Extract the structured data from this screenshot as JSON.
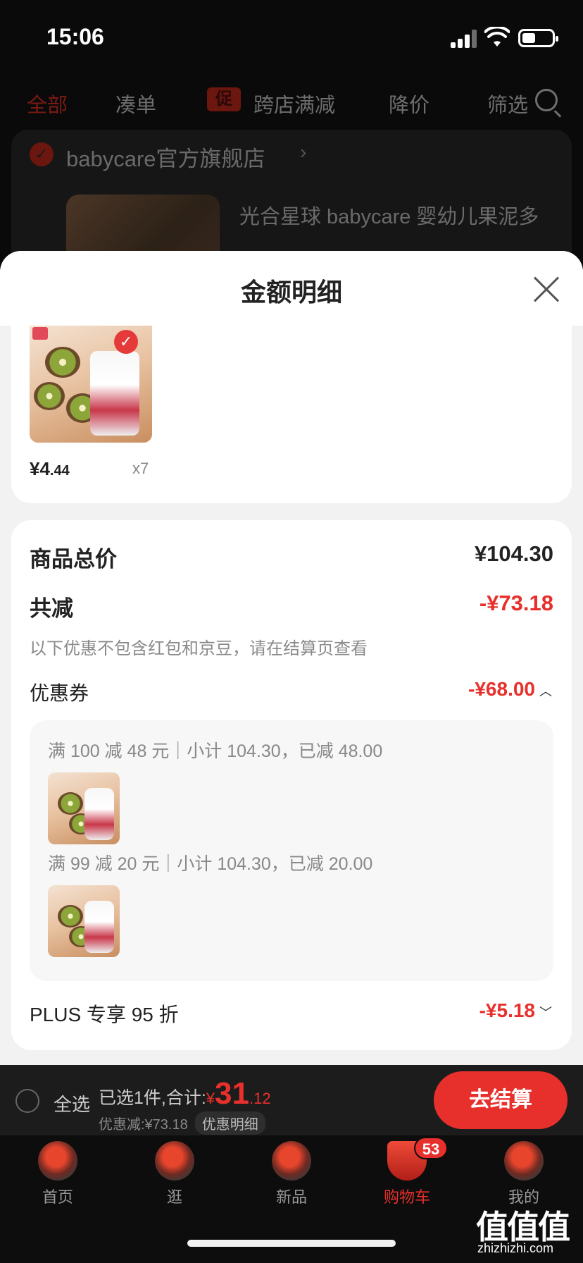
{
  "status_bar": {
    "time": "15:06"
  },
  "filter_bar": {
    "tabs": [
      "全部",
      "凑单",
      "跨店满减",
      "降价",
      "筛选"
    ],
    "promo_tag": "促"
  },
  "shop": {
    "name": "babycare官方旗舰店",
    "arrow": "›",
    "product_title": "光合星球 babycare 婴幼儿果泥多"
  },
  "sheet": {
    "title": "金额明细",
    "product": {
      "price_main": "¥4",
      "price_cents": ".44",
      "qty": "x7"
    },
    "summary": {
      "total_label": "商品总价",
      "total_value": "¥104.30",
      "reduce_label": "共减",
      "reduce_value": "-¥73.18",
      "hint": "以下优惠不包含红包和京豆，请在结算页查看",
      "coupon_label": "优惠券",
      "coupon_value": "-¥68.00",
      "coupons": [
        "满 100 减 48 元｜小计 104.30，已减 48.00",
        "满 99 减 20 元｜小计 104.30，已减 20.00"
      ],
      "plus_label": "PLUS 专享 95 折",
      "plus_value": "-¥5.18"
    }
  },
  "checkout": {
    "select_all": "全选",
    "selected_text": "已选1件,合计:",
    "total_currency": "¥",
    "total_int": "31",
    "total_dec": ".12",
    "discount_text": "优惠减:¥73.18",
    "detail_pill": "优惠明细",
    "button": "去结算"
  },
  "tabbar": {
    "items": [
      "首页",
      "逛",
      "新品",
      "购物车",
      "我的"
    ],
    "cart_badge": "53",
    "watermark": "值值值",
    "watermark_url": "zhizhizhi.com"
  },
  "colors": {
    "accent": "#e7302c",
    "sheet_bg": "#f2f2f2"
  }
}
